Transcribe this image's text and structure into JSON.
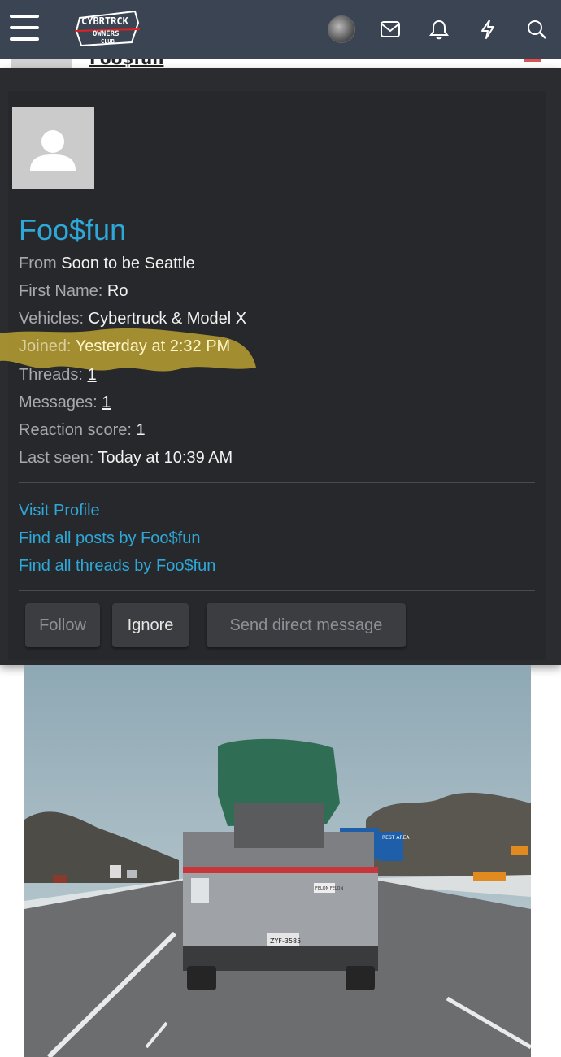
{
  "header": {
    "menu_icon": "hamburger-icon",
    "logo_text_top": "CYBRTRCK",
    "logo_text_mid": "OWNERS",
    "logo_text_bottom": "CLUB",
    "icons": [
      "avatar",
      "mail-icon",
      "bell-icon",
      "bolt-icon",
      "search-icon"
    ]
  },
  "behind": {
    "partial_title": "Foo$fun"
  },
  "profile": {
    "username": "Foo$fun",
    "from_label": "From",
    "from_value": "Soon to be Seattle",
    "first_name_label": "First Name:",
    "first_name_value": "Ro",
    "vehicles_label": "Vehicles:",
    "vehicles_value": "Cybertruck & Model X",
    "joined_label": "Joined:",
    "joined_value": "Yesterday at 2:32 PM",
    "threads_label": "Threads:",
    "threads_value": "1",
    "messages_label": "Messages:",
    "messages_value": "1",
    "reaction_label": "Reaction score:",
    "reaction_value": "1",
    "last_seen_label": "Last seen:",
    "last_seen_value": "Today at 10:39 AM"
  },
  "links": {
    "visit_profile": "Visit Profile",
    "find_posts": "Find all posts by Foo$fun",
    "find_threads": "Find all threads by Foo$fun"
  },
  "actions": {
    "follow": "Follow",
    "ignore": "Ignore",
    "send_dm": "Send direct message"
  },
  "photo": {
    "sign_rest_area": "REST AREA",
    "plate": "ZYF-3585",
    "sticker": "FELON FELON"
  },
  "colors": {
    "topbar": "#3a4452",
    "card": "#2b2c2f",
    "link": "#2ea8d8",
    "highlight": "#b8a032"
  }
}
